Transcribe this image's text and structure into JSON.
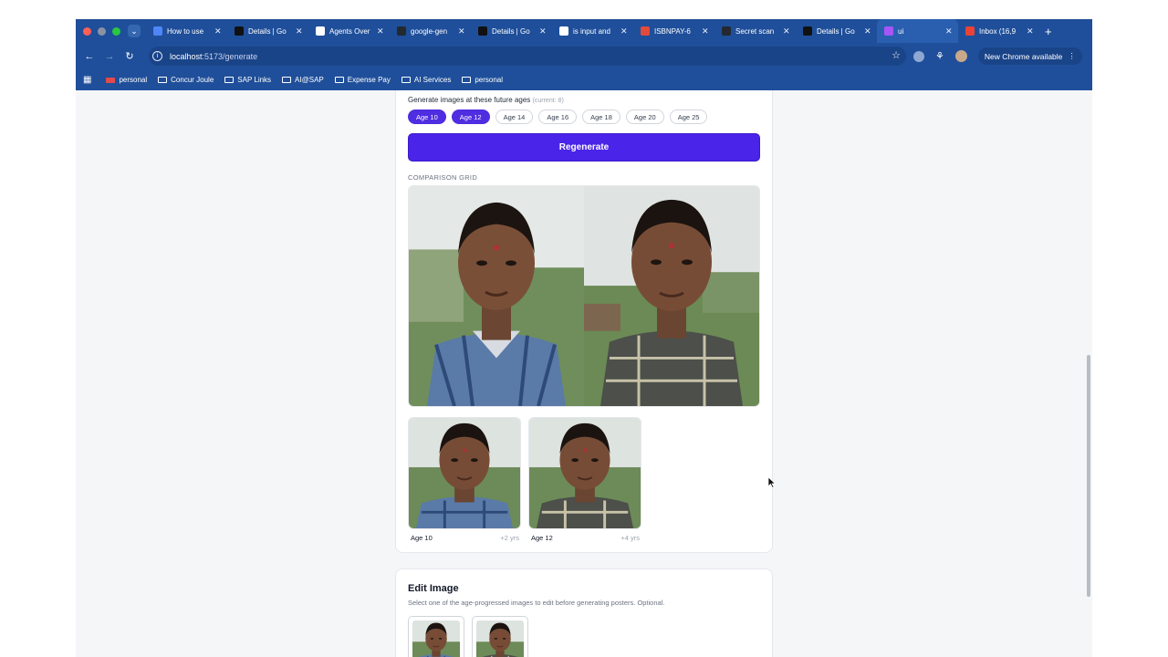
{
  "browser": {
    "tabs": [
      {
        "title": "How to use",
        "favicon": "docs-icon",
        "color": "#4f86f7"
      },
      {
        "title": "Details | Go",
        "favicon": "av-icon",
        "color": "#111111"
      },
      {
        "title": "Agents Over",
        "favicon": "google-icon",
        "color": "#ffffff"
      },
      {
        "title": "google-gen",
        "favicon": "github-icon",
        "color": "#24292f"
      },
      {
        "title": "Details | Go",
        "favicon": "av-icon",
        "color": "#111111"
      },
      {
        "title": "is input and",
        "favicon": "google-icon",
        "color": "#ffffff"
      },
      {
        "title": "ISBNPAY-6",
        "favicon": "ring-icon",
        "color": "#e24a3b"
      },
      {
        "title": "Secret scan",
        "favicon": "github-icon",
        "color": "#24292f"
      },
      {
        "title": "Details | Go",
        "favicon": "av-icon",
        "color": "#111111"
      },
      {
        "title": "ui",
        "favicon": "vite-icon",
        "color": "#a855f7"
      },
      {
        "title": "Inbox (16,9",
        "favicon": "gmail-icon",
        "color": "#ea4335"
      }
    ],
    "active_tab_index": 9,
    "url_host": "localhost",
    "url_path": ":5173/generate",
    "chrome_button": "New Chrome available",
    "bookmarks": [
      {
        "label": "personal",
        "icon": "sap-icon"
      },
      {
        "label": "Concur Joule",
        "icon": "folder-icon"
      },
      {
        "label": "SAP Links",
        "icon": "folder-icon"
      },
      {
        "label": "AI@SAP",
        "icon": "folder-icon"
      },
      {
        "label": "Expense Pay",
        "icon": "folder-icon"
      },
      {
        "label": "AI Services",
        "icon": "folder-icon"
      },
      {
        "label": "personal",
        "icon": "folder-icon"
      }
    ]
  },
  "generate": {
    "ages_label": "Generate images at these future ages",
    "current_note": "(current: 8)",
    "ages": [
      {
        "label": "Age 10",
        "selected": true
      },
      {
        "label": "Age 12",
        "selected": true
      },
      {
        "label": "Age 14",
        "selected": false
      },
      {
        "label": "Age 16",
        "selected": false
      },
      {
        "label": "Age 18",
        "selected": false
      },
      {
        "label": "Age 20",
        "selected": false
      },
      {
        "label": "Age 25",
        "selected": false
      }
    ],
    "regenerate_label": "Regenerate",
    "comparison_label": "COMPARISON GRID",
    "results": [
      {
        "age": "Age 10",
        "delta": "+2 yrs"
      },
      {
        "age": "Age 12",
        "delta": "+4 yrs"
      }
    ]
  },
  "edit": {
    "title": "Edit Image",
    "subtitle": "Select one of the age-progressed images to edit before generating posters. Optional."
  },
  "colors": {
    "accent": "#4a24e8",
    "browser_chrome": "#1f4f9a"
  }
}
